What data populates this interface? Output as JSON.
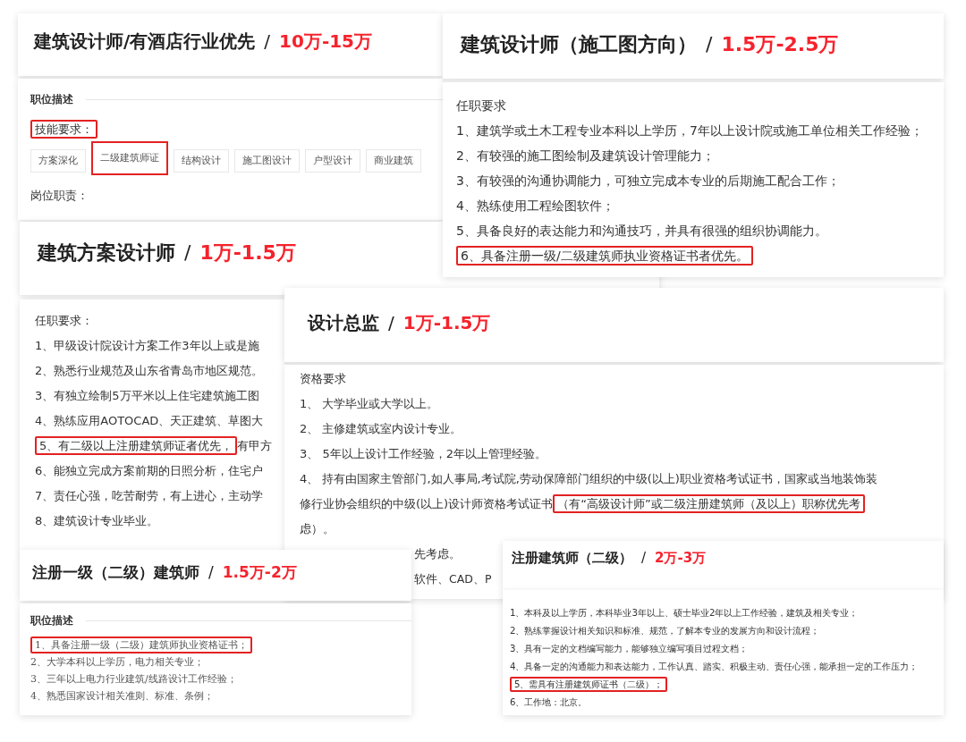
{
  "cards": [
    {
      "title": "建筑设计师/有酒店行业优先",
      "separator": "/",
      "salary": "10万-15万",
      "body": [
        {
          "kind": "section",
          "text": "职位描述"
        },
        {
          "kind": "line",
          "parts": [
            {
              "text": "技能要求：",
              "highlighted": true
            }
          ]
        },
        {
          "kind": "tags",
          "tags": [
            {
              "text": "方案深化",
              "highlighted": false
            },
            {
              "text": "二级建筑师证",
              "highlighted": true
            },
            {
              "text": "结构设计",
              "highlighted": false
            },
            {
              "text": "施工图设计",
              "highlighted": false
            },
            {
              "text": "户型设计",
              "highlighted": false
            },
            {
              "text": "商业建筑",
              "highlighted": false
            }
          ]
        },
        {
          "kind": "line",
          "parts": [
            {
              "text": "岗位职责：",
              "highlighted": false
            }
          ]
        }
      ]
    },
    {
      "title": "建筑设计师（施工图方向）",
      "separator": "/",
      "salary": "1.5万-2.5万",
      "body": [
        {
          "kind": "line",
          "parts": [
            {
              "text": "任职要求",
              "highlighted": false
            }
          ]
        },
        {
          "kind": "line",
          "parts": [
            {
              "text": "1、建筑学或土木工程专业本科以上学历，7年以上设计院或施工单位相关工作经验；",
              "highlighted": false
            }
          ]
        },
        {
          "kind": "line",
          "parts": [
            {
              "text": "2、有较强的施工图绘制及建筑设计管理能力；",
              "highlighted": false
            }
          ]
        },
        {
          "kind": "line",
          "parts": [
            {
              "text": "3、有较强的沟通协调能力，可独立完成本专业的后期施工配合工作；",
              "highlighted": false
            }
          ]
        },
        {
          "kind": "line",
          "parts": [
            {
              "text": "4、熟练使用工程绘图软件；",
              "highlighted": false
            }
          ]
        },
        {
          "kind": "line",
          "parts": [
            {
              "text": "5、具备良好的表达能力和沟通技巧，并具有很强的组织协调能力。",
              "highlighted": false
            }
          ]
        },
        {
          "kind": "line",
          "parts": [
            {
              "text": "6、具备注册一级/二级建筑师执业资格证书者优先。",
              "highlighted": true
            }
          ]
        }
      ]
    },
    {
      "title": "建筑方案设计师",
      "separator": "/",
      "salary": "1万-1.5万",
      "body": [
        {
          "kind": "line",
          "parts": [
            {
              "text": "任职要求：",
              "highlighted": false
            }
          ]
        },
        {
          "kind": "line",
          "parts": [
            {
              "text": "1、甲级设计院设计方案工作3年以上或是施",
              "highlighted": false
            }
          ]
        },
        {
          "kind": "line",
          "parts": [
            {
              "text": "2、熟悉行业规范及山东省青岛市地区规范。",
              "highlighted": false
            }
          ]
        },
        {
          "kind": "line",
          "parts": [
            {
              "text": "3、有独立绘制5万平米以上住宅建筑施工图",
              "highlighted": false
            }
          ]
        },
        {
          "kind": "line",
          "parts": [
            {
              "text": "4、熟练应用AOTOCAD、天正建筑、草图大",
              "highlighted": false
            }
          ]
        },
        {
          "kind": "line",
          "parts": [
            {
              "text": "5、有二级以上注册建筑师证者优先，",
              "highlighted": true
            },
            {
              "text": "有甲方",
              "highlighted": false
            }
          ]
        },
        {
          "kind": "line",
          "parts": [
            {
              "text": "6、能独立完成方案前期的日照分析，住宅户",
              "highlighted": false
            }
          ]
        },
        {
          "kind": "line",
          "parts": [
            {
              "text": "7、责任心强，吃苦耐劳，有上进心，主动学",
              "highlighted": false
            }
          ]
        },
        {
          "kind": "line",
          "parts": [
            {
              "text": "8、建筑设计专业毕业。",
              "highlighted": false
            }
          ]
        }
      ]
    },
    {
      "title": "设计总监",
      "separator": "/",
      "salary": "1万-1.5万",
      "body": [
        {
          "kind": "line",
          "parts": [
            {
              "text": "资格要求",
              "highlighted": false
            }
          ]
        },
        {
          "kind": "line",
          "parts": [
            {
              "text": "1、 大学毕业或大学以上。",
              "highlighted": false
            }
          ]
        },
        {
          "kind": "line",
          "parts": [
            {
              "text": "2、 主修建筑或室内设计专业。",
              "highlighted": false
            }
          ]
        },
        {
          "kind": "line",
          "parts": [
            {
              "text": "3、 5年以上设计工作经验，2年以上管理经验。",
              "highlighted": false
            }
          ]
        },
        {
          "kind": "line",
          "parts": [
            {
              "text": "4、 持有由国家主管部门,如人事局,考试院,劳动保障部门组织的中级(以上)职业资格考试证书，国家或当地装饰装",
              "highlighted": false
            }
          ]
        },
        {
          "kind": "line",
          "parts": [
            {
              "text": "修行业协会组织的中级(以上)设计师资格考试证书",
              "highlighted": false
            },
            {
              "text": "（有“高级设计师”或二级注册建筑师（及以上）职称优先考",
              "highlighted": true
            }
          ]
        },
        {
          "kind": "line",
          "parts": [
            {
              "text": "虑）。",
              "highlighted": false
            }
          ]
        },
        {
          "kind": "fragment",
          "text": "先考虑。"
        },
        {
          "kind": "fragment",
          "text": "软件、CAD、P"
        }
      ]
    },
    {
      "title": "注册一级（二级）建筑师",
      "separator": "/",
      "salary": "1.5万-2万",
      "body": [
        {
          "kind": "section",
          "text": "职位描述"
        },
        {
          "kind": "line",
          "parts": [
            {
              "text": "1、具备注册一级（二级）建筑师执业资格证书；",
              "highlighted": true
            }
          ]
        },
        {
          "kind": "line",
          "parts": [
            {
              "text": "2、大学本科以上学历，电力相关专业；",
              "highlighted": false
            }
          ]
        },
        {
          "kind": "line",
          "parts": [
            {
              "text": "3、三年以上电力行业建筑/线路设计工作经验；",
              "highlighted": false
            }
          ]
        },
        {
          "kind": "line",
          "parts": [
            {
              "text": "4、熟悉国家设计相关准则、标准、条例；",
              "highlighted": false
            }
          ]
        }
      ]
    },
    {
      "title": "注册建筑师（二级）",
      "separator": "/",
      "salary": "2万-3万",
      "body": [
        {
          "kind": "line",
          "parts": [
            {
              "text": "1、本科及以上学历，本科毕业3年以上、硕士毕业2年以上工作经验，建筑及相关专业；",
              "highlighted": false
            }
          ]
        },
        {
          "kind": "line",
          "parts": [
            {
              "text": "2、熟练掌握设计相关知识和标准、规范，了解本专业的发展方向和设计流程；",
              "highlighted": false
            }
          ]
        },
        {
          "kind": "line",
          "parts": [
            {
              "text": "3、具有一定的文档编写能力，能够独立编写项目过程文档；",
              "highlighted": false
            }
          ]
        },
        {
          "kind": "line",
          "parts": [
            {
              "text": "4、具备一定的沟通能力和表达能力，工作认真、踏实、积极主动、责任心强，能承担一定的工作压力；",
              "highlighted": false
            }
          ]
        },
        {
          "kind": "line",
          "parts": [
            {
              "text": "5、需具有注册建筑师证书（二级）；",
              "highlighted": true
            }
          ]
        },
        {
          "kind": "line",
          "parts": [
            {
              "text": "6、工作地：北京。",
              "highlighted": false
            }
          ]
        }
      ]
    }
  ]
}
